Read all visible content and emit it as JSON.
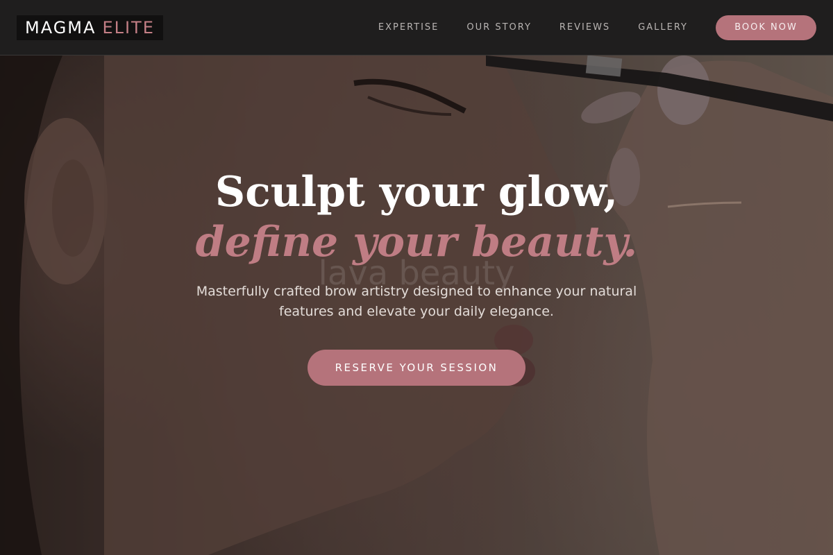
{
  "brand": {
    "name_primary": "MAGMA",
    "name_accent": "ELITE",
    "accent_color": "#c47f86"
  },
  "nav": {
    "links": [
      {
        "label": "EXPERTISE"
      },
      {
        "label": "OUR STORY"
      },
      {
        "label": "REVIEWS"
      },
      {
        "label": "GALLERY"
      }
    ],
    "cta_label": "BOOK NOW"
  },
  "hero": {
    "headline_line1": "Sculpt your glow,",
    "headline_line2": "define your beauty.",
    "watermark_text": "lava beauty",
    "subtext": "Masterfully crafted brow artistry designed to enhance your natural features and elevate your daily elegance.",
    "cta_label": "RESERVE YOUR SESSION",
    "background_image": "woman-profile-makeup-brush-photo"
  },
  "colors": {
    "primary_button": "#b5737b",
    "navbar_bg": "#1f1e1e"
  }
}
